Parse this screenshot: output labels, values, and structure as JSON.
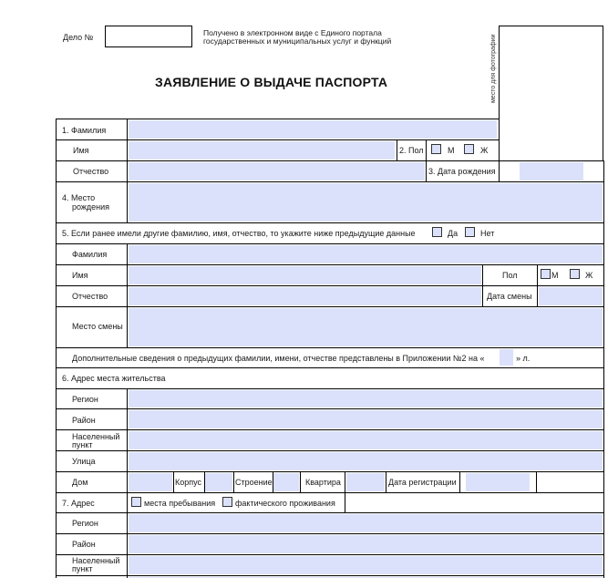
{
  "header": {
    "case_label": "Дело №",
    "case_value": "",
    "received_line1": "Получено в электронном виде с Единого портала",
    "received_line2": "государственных и муниципальных услуг и функций",
    "photo_label": "место для фотографии",
    "title": "ЗАЯВЛЕНИЕ О ВЫДАЧЕ ПАСПОРТА"
  },
  "section1": {
    "surname_label": "1. Фамилия",
    "name_label": "Имя",
    "patronymic_label": "Отчество",
    "sex_label": "2. Пол",
    "sex_m": "М",
    "sex_f": "Ж",
    "birthdate_label": "3. Дата рождения",
    "birthplace_label_1": "4. Место",
    "birthplace_label_2": "рождения"
  },
  "section5": {
    "question": "5. Если ранее имели другие фамилию, имя, отчество, то укажите ниже предыдущие данные",
    "yes": "Да",
    "no": "Нет",
    "surname_label": "Фамилия",
    "name_label": "Имя",
    "patronymic_label": "Отчество",
    "sex_label": "Пол",
    "sex_m": "М",
    "sex_f": "Ж",
    "change_date_label": "Дата смены",
    "change_place_label": "Место смены",
    "extra_prefix": "Дополнительные сведения о предыдущих фамилии, имени, отчестве представлены в Приложении №2 на «",
    "extra_suffix": "» л."
  },
  "section6": {
    "title": "6. Адрес места жительства",
    "region_label": "Регион",
    "district_label": "Район",
    "locality_label_1": "Населенный",
    "locality_label_2": "пункт",
    "street_label": "Улица",
    "house_label": "Дом",
    "building_label": "Корпус",
    "structure_label": "Строение",
    "apartment_label": "Квартира",
    "reg_date_label": "Дата регистрации"
  },
  "section7": {
    "title": "7. Адрес",
    "option_stay": "места пребывания",
    "option_actual": "фактического проживания",
    "region_label": "Регион",
    "district_label": "Район",
    "locality_label_1": "Населенный",
    "locality_label_2": "пункт"
  },
  "colors": {
    "field_fill": "#dbe1fb",
    "border": "#000000"
  }
}
